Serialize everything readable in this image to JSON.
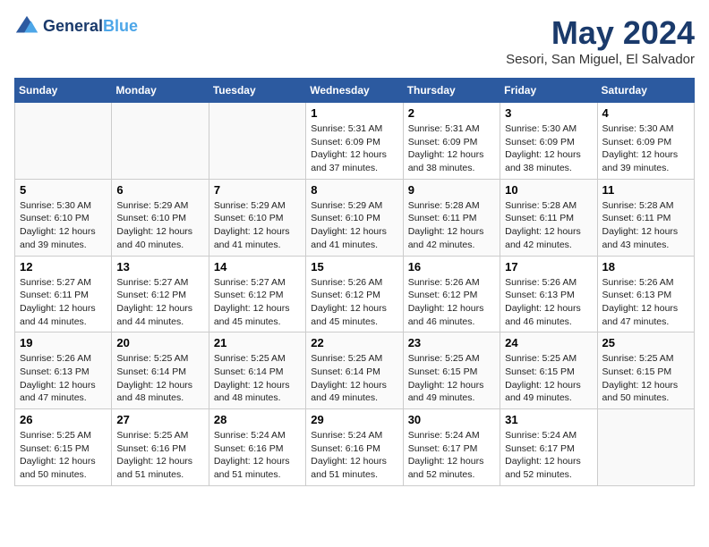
{
  "header": {
    "logo_line1": "General",
    "logo_line2": "Blue",
    "title": "May 2024",
    "subtitle": "Sesori, San Miguel, El Salvador"
  },
  "weekdays": [
    "Sunday",
    "Monday",
    "Tuesday",
    "Wednesday",
    "Thursday",
    "Friday",
    "Saturday"
  ],
  "weeks": [
    [
      {
        "day": "",
        "info": ""
      },
      {
        "day": "",
        "info": ""
      },
      {
        "day": "",
        "info": ""
      },
      {
        "day": "1",
        "info": "Sunrise: 5:31 AM\nSunset: 6:09 PM\nDaylight: 12 hours\nand 37 minutes."
      },
      {
        "day": "2",
        "info": "Sunrise: 5:31 AM\nSunset: 6:09 PM\nDaylight: 12 hours\nand 38 minutes."
      },
      {
        "day": "3",
        "info": "Sunrise: 5:30 AM\nSunset: 6:09 PM\nDaylight: 12 hours\nand 38 minutes."
      },
      {
        "day": "4",
        "info": "Sunrise: 5:30 AM\nSunset: 6:09 PM\nDaylight: 12 hours\nand 39 minutes."
      }
    ],
    [
      {
        "day": "5",
        "info": "Sunrise: 5:30 AM\nSunset: 6:10 PM\nDaylight: 12 hours\nand 39 minutes."
      },
      {
        "day": "6",
        "info": "Sunrise: 5:29 AM\nSunset: 6:10 PM\nDaylight: 12 hours\nand 40 minutes."
      },
      {
        "day": "7",
        "info": "Sunrise: 5:29 AM\nSunset: 6:10 PM\nDaylight: 12 hours\nand 41 minutes."
      },
      {
        "day": "8",
        "info": "Sunrise: 5:29 AM\nSunset: 6:10 PM\nDaylight: 12 hours\nand 41 minutes."
      },
      {
        "day": "9",
        "info": "Sunrise: 5:28 AM\nSunset: 6:11 PM\nDaylight: 12 hours\nand 42 minutes."
      },
      {
        "day": "10",
        "info": "Sunrise: 5:28 AM\nSunset: 6:11 PM\nDaylight: 12 hours\nand 42 minutes."
      },
      {
        "day": "11",
        "info": "Sunrise: 5:28 AM\nSunset: 6:11 PM\nDaylight: 12 hours\nand 43 minutes."
      }
    ],
    [
      {
        "day": "12",
        "info": "Sunrise: 5:27 AM\nSunset: 6:11 PM\nDaylight: 12 hours\nand 44 minutes."
      },
      {
        "day": "13",
        "info": "Sunrise: 5:27 AM\nSunset: 6:12 PM\nDaylight: 12 hours\nand 44 minutes."
      },
      {
        "day": "14",
        "info": "Sunrise: 5:27 AM\nSunset: 6:12 PM\nDaylight: 12 hours\nand 45 minutes."
      },
      {
        "day": "15",
        "info": "Sunrise: 5:26 AM\nSunset: 6:12 PM\nDaylight: 12 hours\nand 45 minutes."
      },
      {
        "day": "16",
        "info": "Sunrise: 5:26 AM\nSunset: 6:12 PM\nDaylight: 12 hours\nand 46 minutes."
      },
      {
        "day": "17",
        "info": "Sunrise: 5:26 AM\nSunset: 6:13 PM\nDaylight: 12 hours\nand 46 minutes."
      },
      {
        "day": "18",
        "info": "Sunrise: 5:26 AM\nSunset: 6:13 PM\nDaylight: 12 hours\nand 47 minutes."
      }
    ],
    [
      {
        "day": "19",
        "info": "Sunrise: 5:26 AM\nSunset: 6:13 PM\nDaylight: 12 hours\nand 47 minutes."
      },
      {
        "day": "20",
        "info": "Sunrise: 5:25 AM\nSunset: 6:14 PM\nDaylight: 12 hours\nand 48 minutes."
      },
      {
        "day": "21",
        "info": "Sunrise: 5:25 AM\nSunset: 6:14 PM\nDaylight: 12 hours\nand 48 minutes."
      },
      {
        "day": "22",
        "info": "Sunrise: 5:25 AM\nSunset: 6:14 PM\nDaylight: 12 hours\nand 49 minutes."
      },
      {
        "day": "23",
        "info": "Sunrise: 5:25 AM\nSunset: 6:15 PM\nDaylight: 12 hours\nand 49 minutes."
      },
      {
        "day": "24",
        "info": "Sunrise: 5:25 AM\nSunset: 6:15 PM\nDaylight: 12 hours\nand 49 minutes."
      },
      {
        "day": "25",
        "info": "Sunrise: 5:25 AM\nSunset: 6:15 PM\nDaylight: 12 hours\nand 50 minutes."
      }
    ],
    [
      {
        "day": "26",
        "info": "Sunrise: 5:25 AM\nSunset: 6:15 PM\nDaylight: 12 hours\nand 50 minutes."
      },
      {
        "day": "27",
        "info": "Sunrise: 5:25 AM\nSunset: 6:16 PM\nDaylight: 12 hours\nand 51 minutes."
      },
      {
        "day": "28",
        "info": "Sunrise: 5:24 AM\nSunset: 6:16 PM\nDaylight: 12 hours\nand 51 minutes."
      },
      {
        "day": "29",
        "info": "Sunrise: 5:24 AM\nSunset: 6:16 PM\nDaylight: 12 hours\nand 51 minutes."
      },
      {
        "day": "30",
        "info": "Sunrise: 5:24 AM\nSunset: 6:17 PM\nDaylight: 12 hours\nand 52 minutes."
      },
      {
        "day": "31",
        "info": "Sunrise: 5:24 AM\nSunset: 6:17 PM\nDaylight: 12 hours\nand 52 minutes."
      },
      {
        "day": "",
        "info": ""
      }
    ]
  ]
}
